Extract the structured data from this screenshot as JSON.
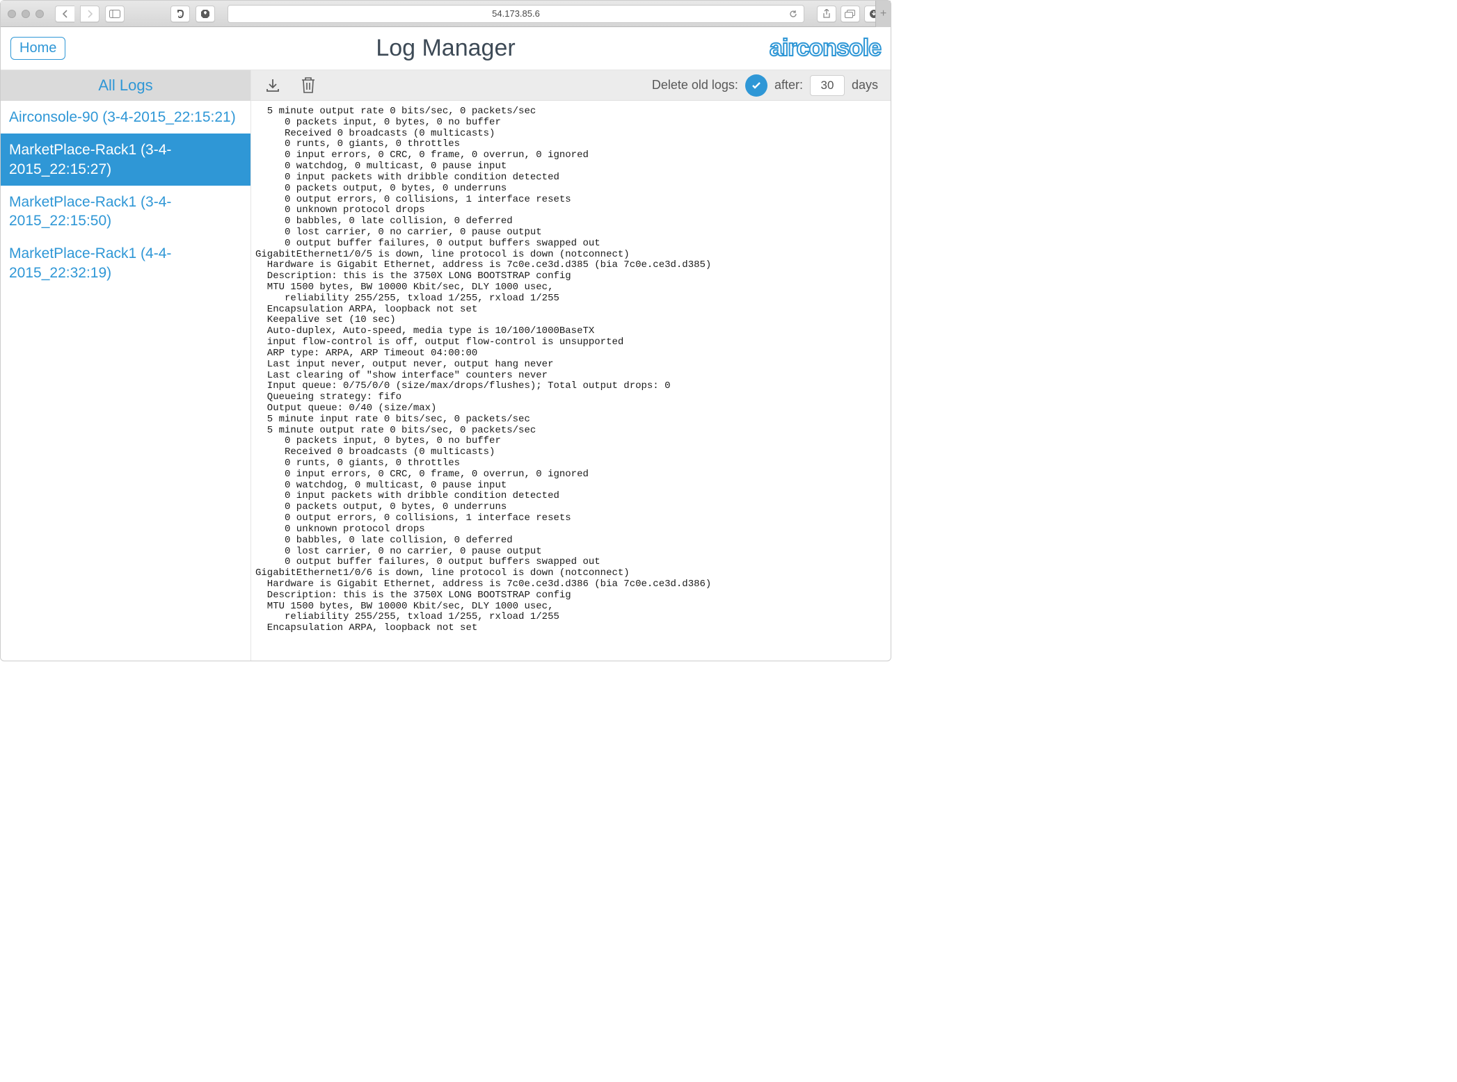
{
  "browser": {
    "url": "54.173.85.6"
  },
  "header": {
    "home_label": "Home",
    "title": "Log Manager",
    "brand": "airconsole"
  },
  "sidebar": {
    "title": "All Logs",
    "items": [
      {
        "label": "Airconsole-90 (3-4-2015_22:15:21)",
        "selected": false
      },
      {
        "label": "MarketPlace-Rack1 (3-4-2015_22:15:27)",
        "selected": true
      },
      {
        "label": "MarketPlace-Rack1 (3-4-2015_22:15:50)",
        "selected": false
      },
      {
        "label": "MarketPlace-Rack1 (4-4-2015_22:32:19)",
        "selected": false
      }
    ]
  },
  "toolbar": {
    "delete_label": "Delete old logs:",
    "after_label": "after:",
    "days_value": "30",
    "days_unit": "days"
  },
  "log_text": "  5 minute output rate 0 bits/sec, 0 packets/sec\n     0 packets input, 0 bytes, 0 no buffer\n     Received 0 broadcasts (0 multicasts)\n     0 runts, 0 giants, 0 throttles\n     0 input errors, 0 CRC, 0 frame, 0 overrun, 0 ignored\n     0 watchdog, 0 multicast, 0 pause input\n     0 input packets with dribble condition detected\n     0 packets output, 0 bytes, 0 underruns\n     0 output errors, 0 collisions, 1 interface resets\n     0 unknown protocol drops\n     0 babbles, 0 late collision, 0 deferred\n     0 lost carrier, 0 no carrier, 0 pause output\n     0 output buffer failures, 0 output buffers swapped out\nGigabitEthernet1/0/5 is down, line protocol is down (notconnect)\n  Hardware is Gigabit Ethernet, address is 7c0e.ce3d.d385 (bia 7c0e.ce3d.d385)\n  Description: this is the 3750X LONG BOOTSTRAP config\n  MTU 1500 bytes, BW 10000 Kbit/sec, DLY 1000 usec,\n     reliability 255/255, txload 1/255, rxload 1/255\n  Encapsulation ARPA, loopback not set\n  Keepalive set (10 sec)\n  Auto-duplex, Auto-speed, media type is 10/100/1000BaseTX\n  input flow-control is off, output flow-control is unsupported\n  ARP type: ARPA, ARP Timeout 04:00:00\n  Last input never, output never, output hang never\n  Last clearing of \"show interface\" counters never\n  Input queue: 0/75/0/0 (size/max/drops/flushes); Total output drops: 0\n  Queueing strategy: fifo\n  Output queue: 0/40 (size/max)\n  5 minute input rate 0 bits/sec, 0 packets/sec\n  5 minute output rate 0 bits/sec, 0 packets/sec\n     0 packets input, 0 bytes, 0 no buffer\n     Received 0 broadcasts (0 multicasts)\n     0 runts, 0 giants, 0 throttles\n     0 input errors, 0 CRC, 0 frame, 0 overrun, 0 ignored\n     0 watchdog, 0 multicast, 0 pause input\n     0 input packets with dribble condition detected\n     0 packets output, 0 bytes, 0 underruns\n     0 output errors, 0 collisions, 1 interface resets\n     0 unknown protocol drops\n     0 babbles, 0 late collision, 0 deferred\n     0 lost carrier, 0 no carrier, 0 pause output\n     0 output buffer failures, 0 output buffers swapped out\nGigabitEthernet1/0/6 is down, line protocol is down (notconnect)\n  Hardware is Gigabit Ethernet, address is 7c0e.ce3d.d386 (bia 7c0e.ce3d.d386)\n  Description: this is the 3750X LONG BOOTSTRAP config\n  MTU 1500 bytes, BW 10000 Kbit/sec, DLY 1000 usec,\n     reliability 255/255, txload 1/255, rxload 1/255\n  Encapsulation ARPA, loopback not set"
}
